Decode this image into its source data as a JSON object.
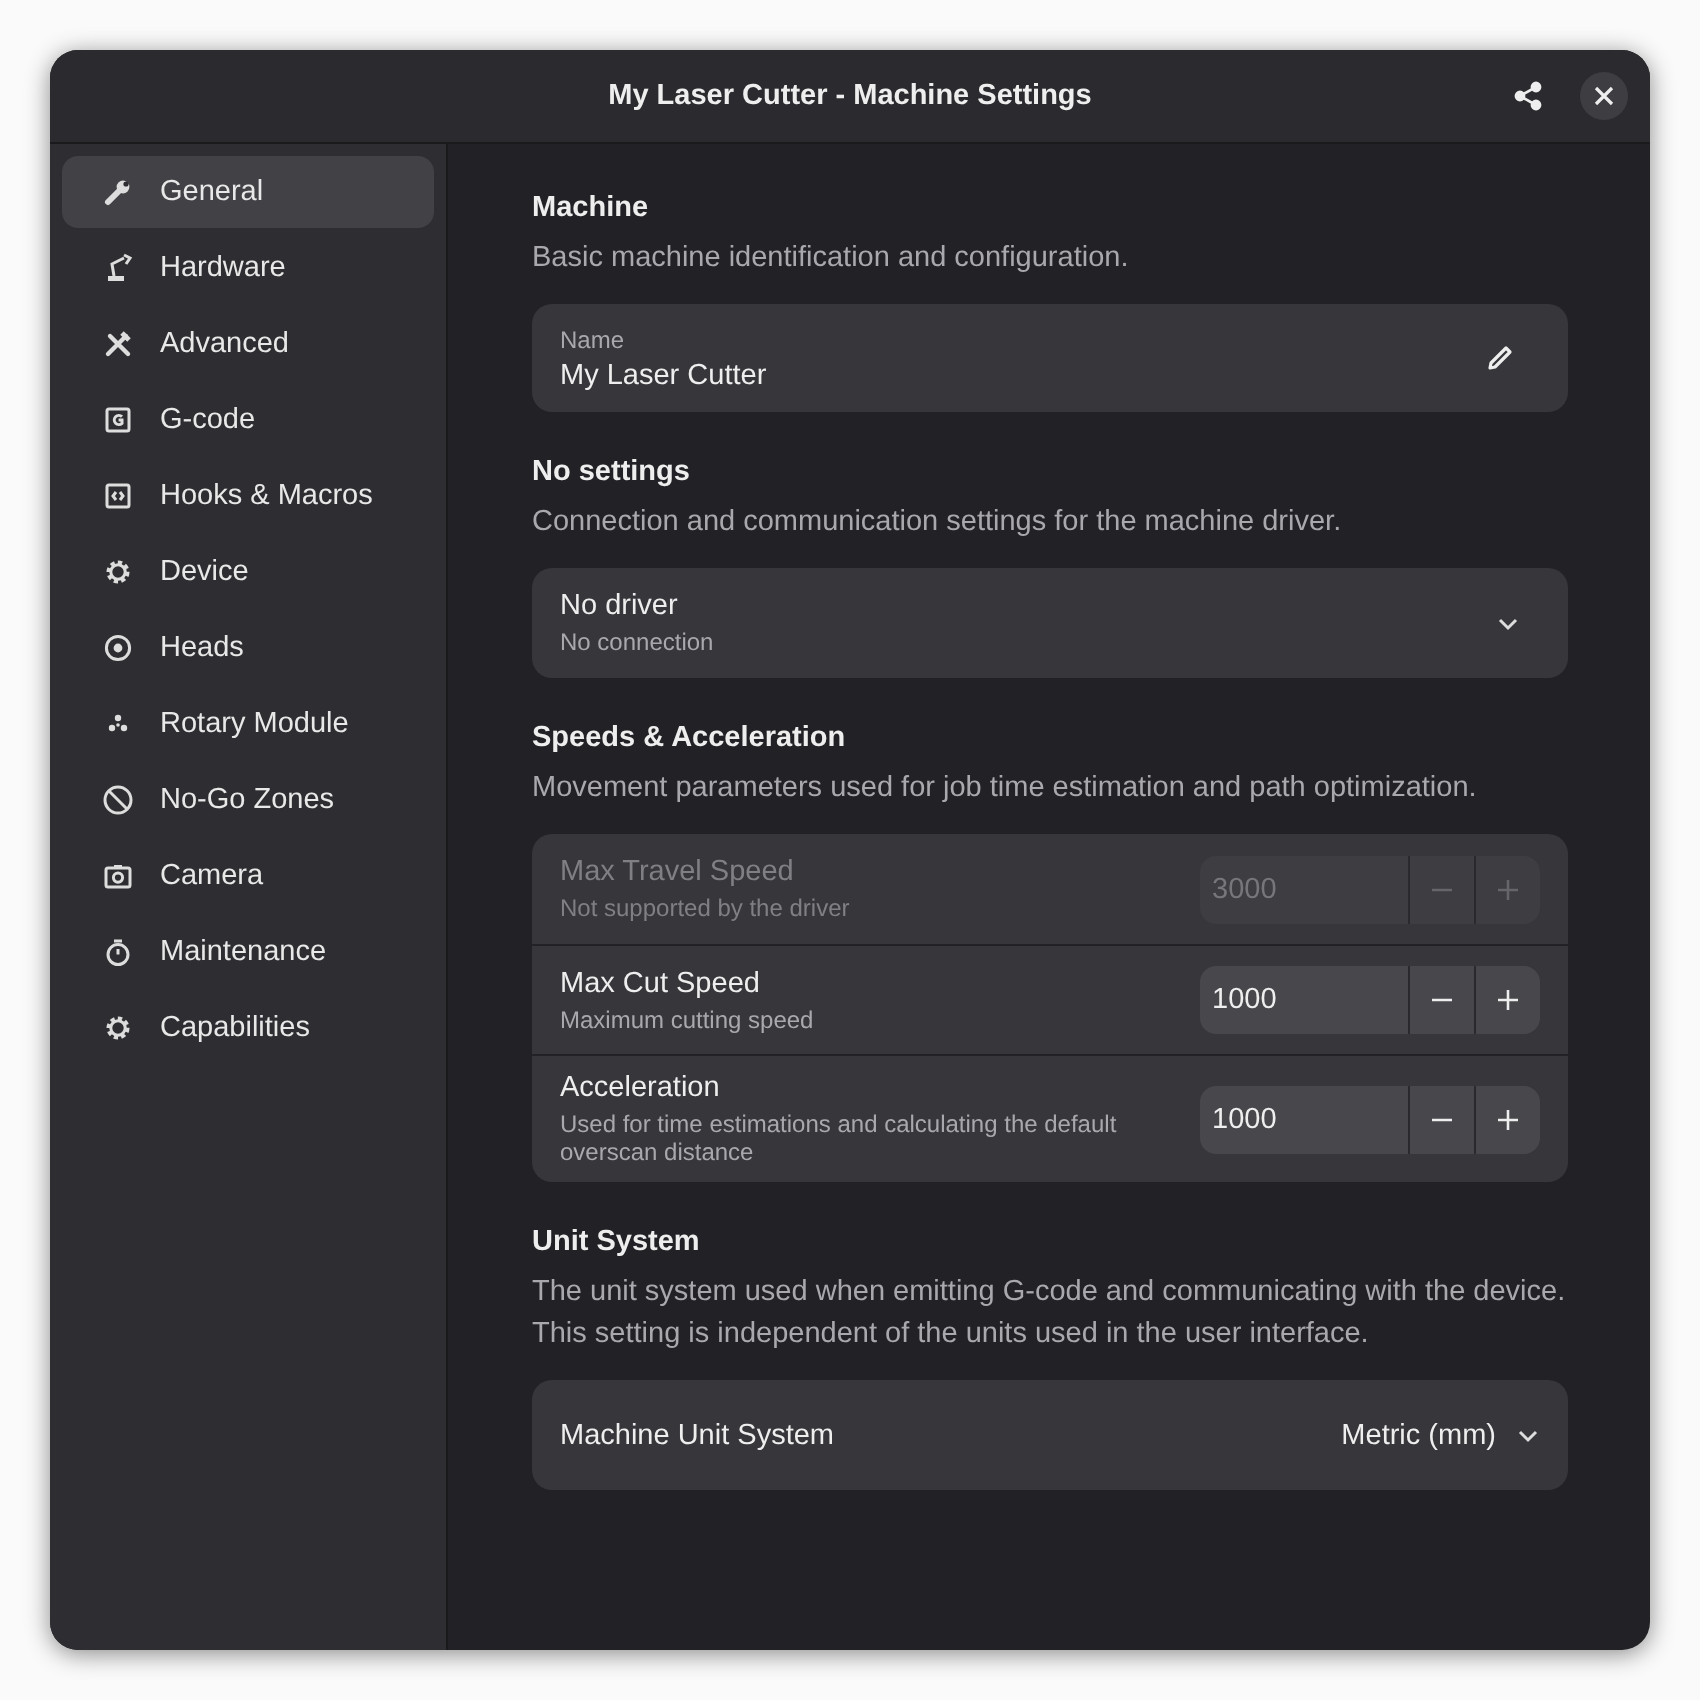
{
  "window": {
    "title": "My Laser Cutter - Machine Settings"
  },
  "sidebar": {
    "items": [
      {
        "label": "General",
        "selected": true
      },
      {
        "label": "Hardware",
        "selected": false
      },
      {
        "label": "Advanced",
        "selected": false
      },
      {
        "label": "G-code",
        "selected": false
      },
      {
        "label": "Hooks & Macros",
        "selected": false
      },
      {
        "label": "Device",
        "selected": false
      },
      {
        "label": "Heads",
        "selected": false
      },
      {
        "label": "Rotary Module",
        "selected": false
      },
      {
        "label": "No-Go Zones",
        "selected": false
      },
      {
        "label": "Camera",
        "selected": false
      },
      {
        "label": "Maintenance",
        "selected": false
      },
      {
        "label": "Capabilities",
        "selected": false
      }
    ]
  },
  "sections": [
    {
      "title": "Machine",
      "description": "Basic machine identification and configuration.",
      "rows": [
        {
          "kind": "text_field",
          "label": "Name",
          "value": "My Laser Cutter"
        }
      ]
    },
    {
      "title": "No settings",
      "description": "Connection and communication settings for the machine driver.",
      "rows": [
        {
          "kind": "dropdown",
          "title": "No driver",
          "subtitle": "No connection"
        }
      ]
    },
    {
      "title": "Speeds & Acceleration",
      "description": "Movement parameters used for job time estimation and path optimization.",
      "rows": [
        {
          "kind": "stepper",
          "title": "Max Travel Speed",
          "subtitle": "Not supported by the driver",
          "value": "3000",
          "disabled": true
        },
        {
          "kind": "stepper",
          "title": "Max Cut Speed",
          "subtitle": "Maximum cutting speed",
          "value": "1000",
          "disabled": false
        },
        {
          "kind": "stepper",
          "title": "Acceleration",
          "subtitle": "Used for time estimations and calculating the default overscan distance",
          "value": "1000",
          "disabled": false
        }
      ]
    },
    {
      "title": "Unit System",
      "description": "The unit system used when emitting G-code and communicating with the device. This setting is independent of the units used in the user interface.",
      "rows": [
        {
          "kind": "combo",
          "title": "Machine Unit System",
          "value": "Metric (mm)"
        }
      ]
    }
  ]
}
